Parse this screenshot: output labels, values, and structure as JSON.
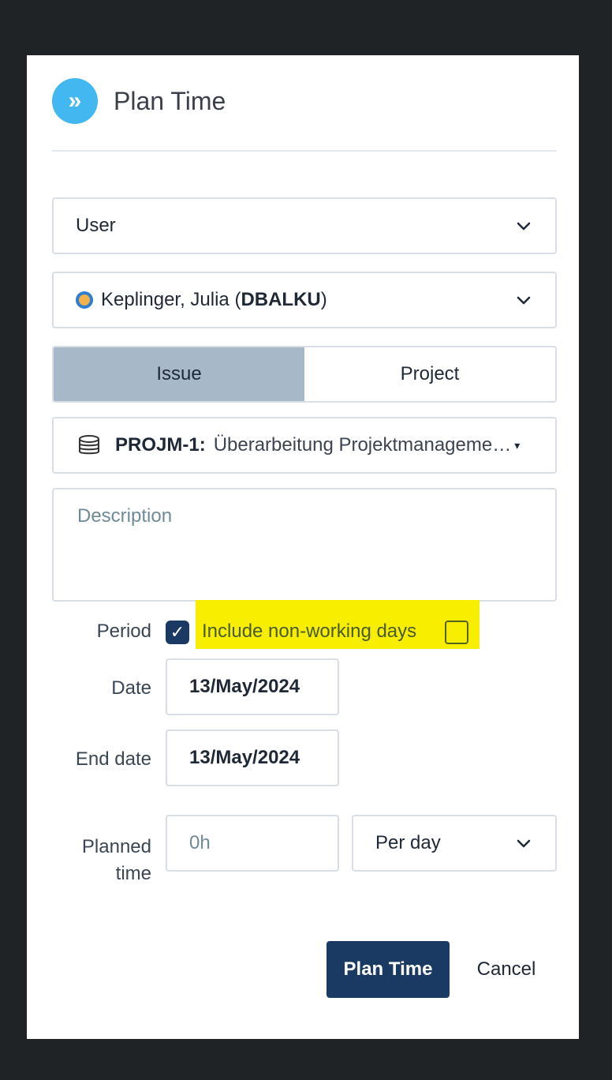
{
  "dialog": {
    "title": "Plan Time"
  },
  "selectors": {
    "assignee_type": "User",
    "person": {
      "name": "Keplinger, Julia (",
      "code": "DBALKU",
      "suffix": ")"
    }
  },
  "toggle": {
    "issue_label": "Issue",
    "project_label": "Project",
    "active": "Issue"
  },
  "issue": {
    "key": "PROJM-1:",
    "title": "Überarbeitung Projektmanageme…"
  },
  "description": {
    "placeholder": "Description"
  },
  "period": {
    "label": "Period",
    "checked": true,
    "nonworking_label": "Include non-working days",
    "nonworking_checked": false
  },
  "dates": {
    "date_label": "Date",
    "date_value": "13/May/2024",
    "end_label": "End date",
    "end_value": "13/May/2024"
  },
  "planned": {
    "label_line1": "Planned",
    "label_line2": "time",
    "value": "0h",
    "unit": "Per day"
  },
  "actions": {
    "primary": "Plan Time",
    "secondary": "Cancel"
  }
}
